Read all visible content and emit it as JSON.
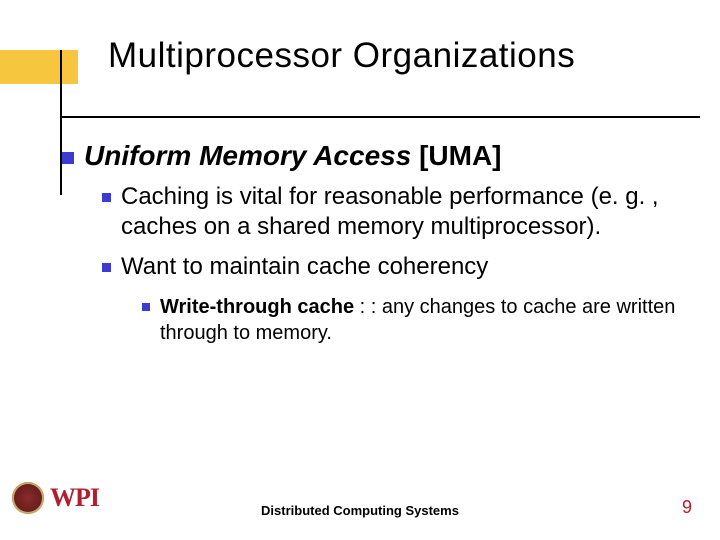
{
  "title": "Multiprocessor Organizations",
  "heading": {
    "italic": "Uniform Memory Access",
    "bracket": " [UMA]"
  },
  "points": [
    "Caching is vital for reasonable performance (e. g. , caches on a shared memory multiprocessor).",
    "Want to maintain cache coherency"
  ],
  "subpoint": {
    "bold": "Write-through cache",
    "rest": " : : any changes to cache are written through to memory."
  },
  "footer": {
    "center": "Distributed Computing Systems",
    "page": "9",
    "logo_text": "WPI"
  }
}
